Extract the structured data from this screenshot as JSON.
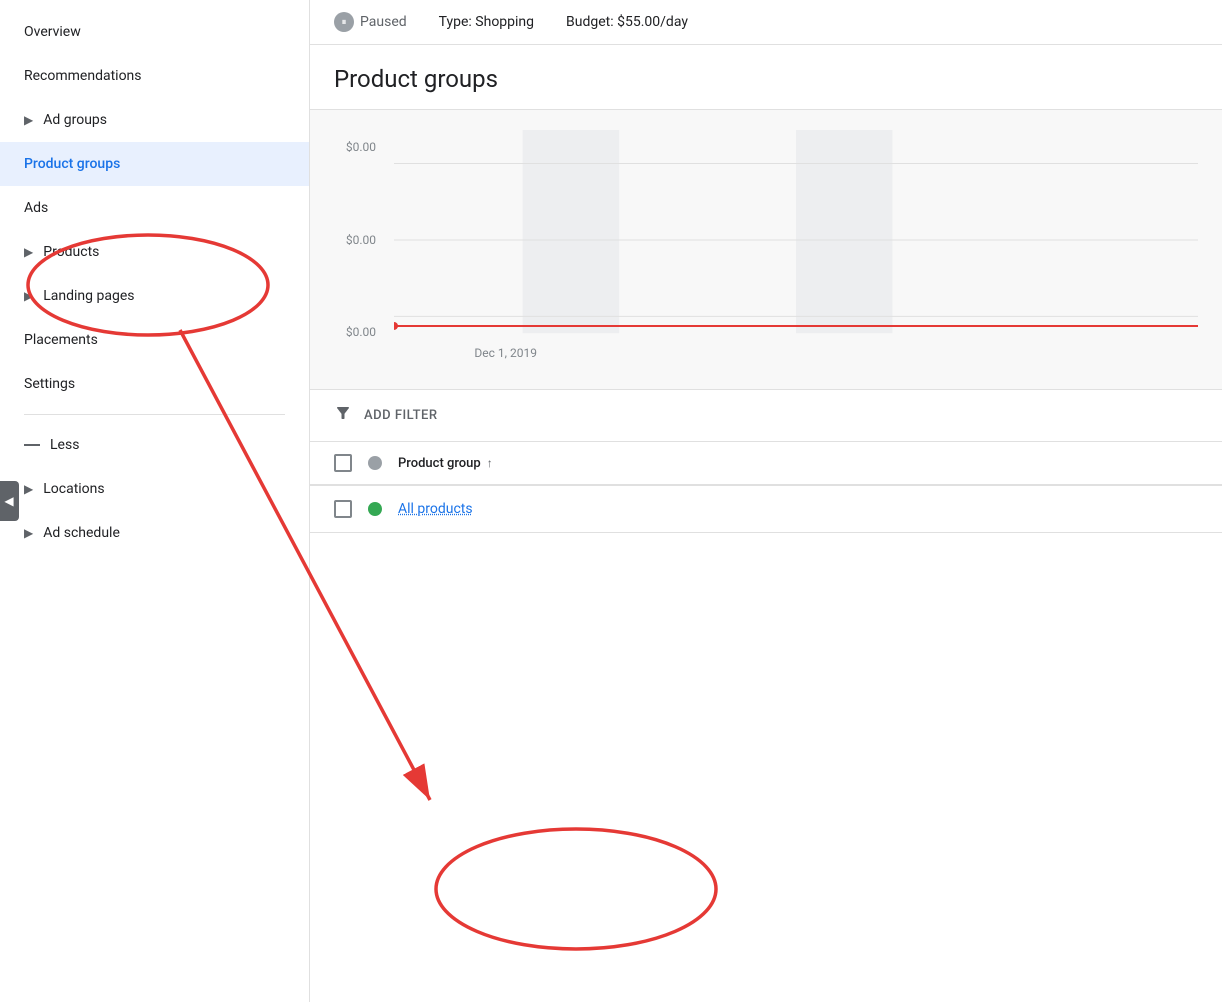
{
  "sidebar": {
    "items": [
      {
        "id": "overview",
        "label": "Overview",
        "hasArrow": false,
        "active": false
      },
      {
        "id": "recommendations",
        "label": "Recommendations",
        "hasArrow": false,
        "active": false
      },
      {
        "id": "ad-groups",
        "label": "Ad groups",
        "hasArrow": true,
        "active": false
      },
      {
        "id": "product-groups",
        "label": "Product groups",
        "hasArrow": false,
        "active": true
      },
      {
        "id": "ads",
        "label": "Ads",
        "hasArrow": false,
        "active": false
      },
      {
        "id": "products",
        "label": "Products",
        "hasArrow": true,
        "active": false
      },
      {
        "id": "landing-pages",
        "label": "Landing pages",
        "hasArrow": true,
        "active": false
      },
      {
        "id": "placements",
        "label": "Placements",
        "hasArrow": false,
        "active": false
      },
      {
        "id": "settings",
        "label": "Settings",
        "hasArrow": false,
        "active": false
      }
    ],
    "lessLabel": "Less",
    "extraItems": [
      {
        "id": "locations",
        "label": "Locations",
        "hasArrow": true
      },
      {
        "id": "ad-schedule",
        "label": "Ad schedule",
        "hasArrow": true
      }
    ]
  },
  "topbar": {
    "status": "Paused",
    "typeLabel": "Type:",
    "typeValue": "Shopping",
    "budgetLabel": "Budget:",
    "budgetValue": "$55.00/day"
  },
  "pageTitle": "Product groups",
  "chart": {
    "yLabels": [
      "$0.00",
      "$0.00",
      "$0.00"
    ],
    "xLabel": "Dec 1, 2019",
    "redLineY": "$0.00"
  },
  "filter": {
    "addFilterLabel": "ADD FILTER"
  },
  "table": {
    "columnHeader": "Product group",
    "rows": [
      {
        "status": "green",
        "text": "All products"
      }
    ]
  },
  "icons": {
    "pause": "⏸",
    "filterFunnel": "▼",
    "sortUp": "↑",
    "arrowRight": "▶",
    "dash": "—"
  }
}
